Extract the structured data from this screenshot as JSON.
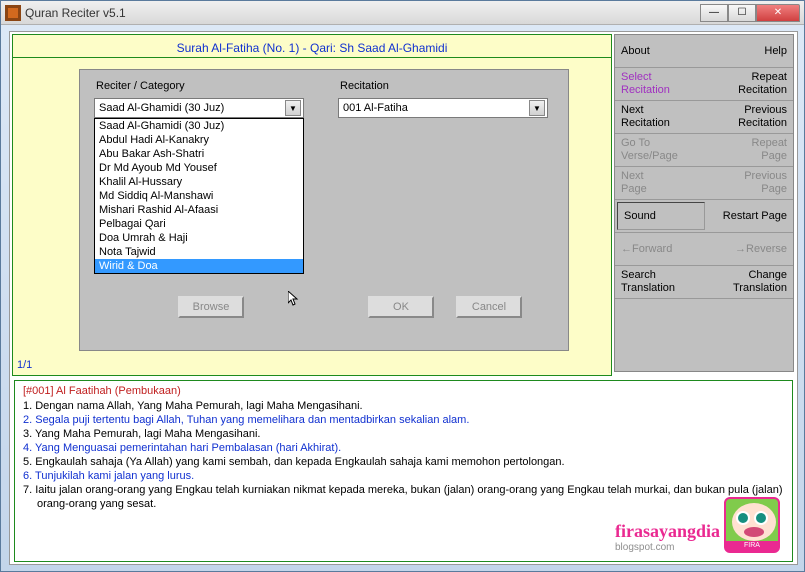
{
  "window": {
    "title": "Quran Reciter v5.1"
  },
  "header": "Surah Al-Fatiha (No. 1) - Qari: Sh Saad Al-Ghamidi",
  "labels": {
    "reciter": "Reciter / Category",
    "recitation": "Recitation"
  },
  "combo": {
    "reciter_value": "Saad Al-Ghamidi (30 Juz)",
    "recitation_value": "001 Al-Fatiha"
  },
  "dropdown": {
    "items": [
      "Saad Al-Ghamidi (30 Juz)",
      "Abdul Hadi Al-Kanakry",
      "Abu Bakar Ash-Shatri",
      "Dr Md Ayoub Md Yousef",
      "Khalil Al-Hussary",
      "Md Siddiq Al-Manshawi",
      "Mishari Rashid Al-Afaasi",
      "Pelbagai Qari",
      "Doa Umrah & Haji",
      "Nota Tajwid",
      "Wirid & Doa"
    ],
    "selected_index": 10
  },
  "buttons": {
    "browse": "Browse",
    "ok": "OK",
    "cancel": "Cancel"
  },
  "page_indicator": "1/1",
  "side": [
    {
      "left": "About",
      "right": "Help",
      "lclass": "",
      "rclass": ""
    },
    {
      "left": "Select\nRecitation",
      "right": "Repeat\nRecitation",
      "lclass": "purple",
      "rclass": ""
    },
    {
      "left": "Next\nRecitation",
      "right": "Previous\nRecitation",
      "lclass": "",
      "rclass": ""
    },
    {
      "left": "Go To\nVerse/Page",
      "right": "Repeat\nPage",
      "lclass": "dim",
      "rclass": "dim"
    },
    {
      "left": "Next\nPage",
      "right": "Previous\nPage",
      "lclass": "dim",
      "rclass": "dim"
    },
    {
      "left": "Sound",
      "right": "Restart Page",
      "lclass": "boxed",
      "rclass": ""
    },
    {
      "left": "←Forward",
      "right": "→Reverse",
      "lclass": "dim",
      "rclass": "dim"
    },
    {
      "left": "Search\nTranslation",
      "right": "Change\nTranslation",
      "lclass": "",
      "rclass": ""
    }
  ],
  "translation": {
    "title": "[#001] Al Faatihah (Pembukaan)",
    "verses": [
      {
        "n": 1,
        "t": "Dengan nama Allah, Yang Maha Pemurah, lagi Maha Mengasihani.",
        "c": ""
      },
      {
        "n": 2,
        "t": "Segala puji tertentu bagi Allah, Tuhan yang memelihara dan mentadbirkan sekalian alam.",
        "c": "blue"
      },
      {
        "n": 3,
        "t": "Yang Maha Pemurah, lagi Maha Mengasihani.",
        "c": ""
      },
      {
        "n": 4,
        "t": "Yang Menguasai pemerintahan hari Pembalasan (hari Akhirat).",
        "c": "blue"
      },
      {
        "n": 5,
        "t": "Engkaulah sahaja (Ya Allah) yang kami sembah, dan kepada Engkaulah sahaja kami memohon pertolongan.",
        "c": ""
      },
      {
        "n": 6,
        "t": "Tunjukilah kami jalan yang lurus.",
        "c": "blue"
      },
      {
        "n": 7,
        "t": "Iaitu jalan orang-orang yang Engkau telah kurniakan nikmat kepada mereka, bukan (jalan) orang-orang yang Engkau telah murkai, dan bukan pula (jalan) orang-orang yang sesat.",
        "c": ""
      }
    ]
  },
  "watermark": {
    "text": "firasayangdia",
    "sub": "blogspot.com",
    "tag": "FIRA"
  }
}
